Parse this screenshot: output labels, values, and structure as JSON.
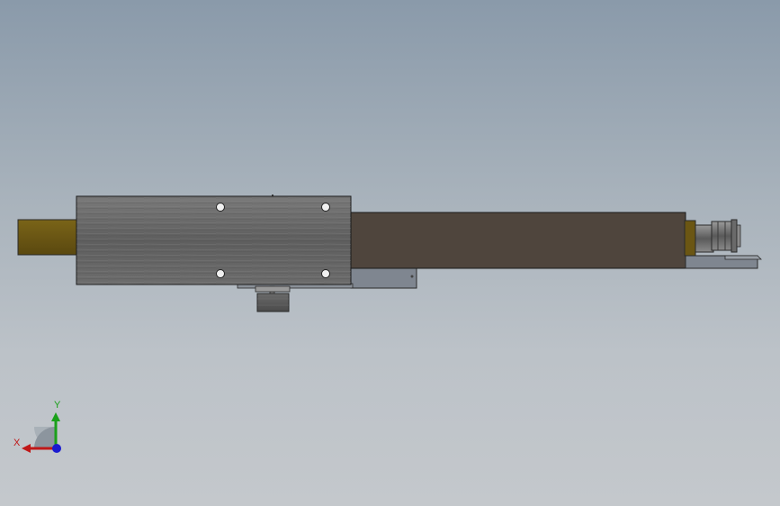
{
  "viewport": {
    "background_top": "#8a9aaa",
    "background_bottom": "#c4c8cc"
  },
  "model": {
    "carriage_color": "#6a6a6a",
    "tube_color": "#4f453d",
    "rod_color": "#6b5613",
    "bracket_color": "#7f8690"
  },
  "triad": {
    "x_label": "X",
    "y_label": "Y",
    "x_color": "#c01818",
    "y_color": "#1aa01a",
    "z_color": "#1a1ad0"
  }
}
